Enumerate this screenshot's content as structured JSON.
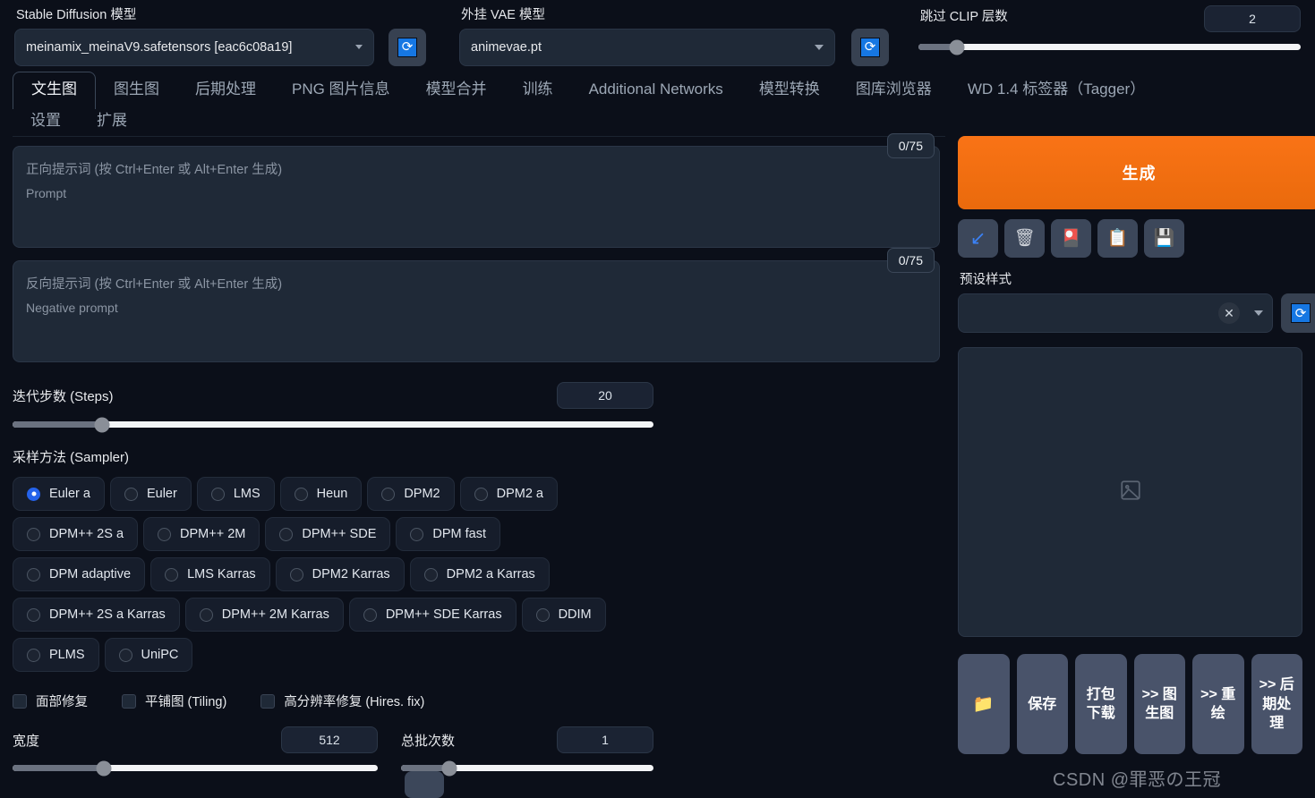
{
  "topbar": {
    "model": {
      "label": "Stable Diffusion 模型",
      "value": "meinamix_meinaV9.safetensors [eac6c08a19]",
      "refresh_icon": "refresh-icon"
    },
    "vae": {
      "label": "外挂 VAE 模型",
      "value": "animevae.pt",
      "refresh_icon": "refresh-icon"
    },
    "clip_skip": {
      "label": "跳过 CLIP 层数",
      "value": "2",
      "fill_percent": 10
    }
  },
  "tabs": {
    "row1": [
      {
        "label": "文生图",
        "active": true
      },
      {
        "label": "图生图",
        "active": false
      },
      {
        "label": "后期处理",
        "active": false
      },
      {
        "label": "PNG 图片信息",
        "active": false
      },
      {
        "label": "模型合并",
        "active": false
      },
      {
        "label": "训练",
        "active": false
      },
      {
        "label": "Additional Networks",
        "active": false
      },
      {
        "label": "模型转换",
        "active": false
      },
      {
        "label": "图库浏览器",
        "active": false
      },
      {
        "label": "WD 1.4 标签器（Tagger）",
        "active": false
      }
    ],
    "row2": [
      {
        "label": "设置",
        "active": false
      },
      {
        "label": "扩展",
        "active": false
      }
    ]
  },
  "prompt": {
    "positive": {
      "token_count": "0/75",
      "value": "",
      "placeholder_line1": "正向提示词 (按 Ctrl+Enter 或 Alt+Enter 生成)",
      "placeholder_line2": "Prompt"
    },
    "negative": {
      "token_count": "0/75",
      "value": "",
      "placeholder_line1": "反向提示词 (按 Ctrl+Enter 或 Alt+Enter 生成)",
      "placeholder_line2": "Negative prompt"
    }
  },
  "actions": {
    "generate_label": "生成",
    "generate_color": "#f97316",
    "tool_icons": [
      {
        "name": "arrow-down-left-icon",
        "glyph": "↙"
      },
      {
        "name": "trash-icon",
        "glyph": "🗑"
      },
      {
        "name": "card-icon",
        "glyph": "🎴"
      },
      {
        "name": "clipboard-icon",
        "glyph": "📋"
      },
      {
        "name": "floppy-save-icon",
        "glyph": "💾"
      }
    ],
    "styles": {
      "label": "预设样式",
      "value": "",
      "clear_glyph": "✕",
      "refresh_icon": "refresh-icon"
    }
  },
  "params": {
    "steps": {
      "label": "迭代步数 (Steps)",
      "value": "20",
      "fill_percent": 14
    },
    "sampler": {
      "label": "采样方法 (Sampler)",
      "selected": "Euler a",
      "rows": [
        [
          "Euler a",
          "Euler",
          "LMS",
          "Heun",
          "DPM2",
          "DPM2 a"
        ],
        [
          "DPM++ 2S a",
          "DPM++ 2M",
          "DPM++ SDE",
          "DPM fast"
        ],
        [
          "DPM adaptive",
          "LMS Karras",
          "DPM2 Karras",
          "DPM2 a Karras"
        ],
        [
          "DPM++ 2S a Karras",
          "DPM++ 2M Karras",
          "DPM++ SDE Karras",
          "DDIM"
        ],
        [
          "PLMS",
          "UniPC"
        ]
      ]
    },
    "checkboxes": [
      {
        "label": "面部修复",
        "checked": false
      },
      {
        "label": "平铺图 (Tiling)",
        "checked": false
      },
      {
        "label": "高分辨率修复 (Hires. fix)",
        "checked": false
      }
    ],
    "width": {
      "label": "宽度",
      "value": "512",
      "fill_percent": 25
    },
    "batch_count": {
      "label": "总批次数",
      "value": "1",
      "fill_percent": 19
    }
  },
  "output": {
    "placeholder_icon": "image-placeholder-icon",
    "buttons": [
      {
        "name": "open-folder-button",
        "label": "📁",
        "icon_only": true
      },
      {
        "name": "save-button",
        "label": "保存",
        "icon_only": false
      },
      {
        "name": "zip-download-button",
        "label": "打包\n下载",
        "icon_only": false
      },
      {
        "name": "send-to-img2img-button",
        "label": ">> 图\n生图",
        "icon_only": false
      },
      {
        "name": "send-to-inpaint-button",
        "label": ">> 重\n绘",
        "icon_only": false
      },
      {
        "name": "send-to-extras-button",
        "label": ">> 后\n期处\n理",
        "icon_only": false
      }
    ]
  },
  "watermark": "CSDN @罪恶の王冠"
}
